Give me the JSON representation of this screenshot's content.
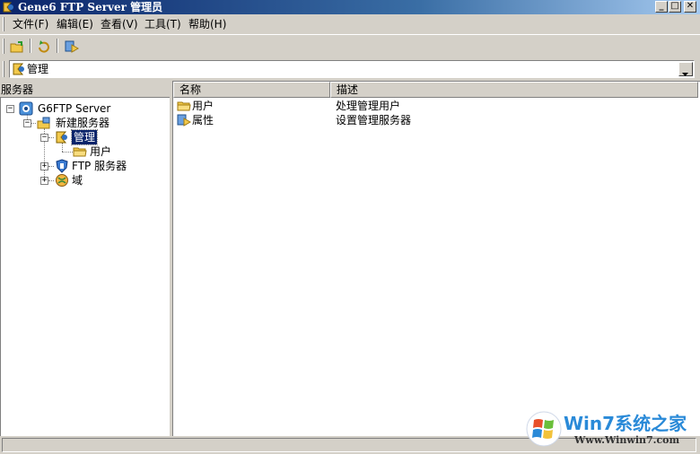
{
  "window": {
    "title": "Gene6 FTP Server 管理员"
  },
  "caption_buttons": {
    "minimize": "_",
    "maximize": "□",
    "close": "✕"
  },
  "menu": [
    {
      "label": "文件(F)"
    },
    {
      "label": "编辑(E)"
    },
    {
      "label": "查看(V)"
    },
    {
      "label": "工具(T)"
    },
    {
      "label": "帮助(H)"
    }
  ],
  "toolbar": {
    "buttons": [
      {
        "icon": "connect-folder-icon"
      },
      {
        "icon": "refresh-icon"
      },
      {
        "icon": "properties-icon"
      }
    ]
  },
  "address": {
    "value": "管理",
    "icon": "admin-icon"
  },
  "tree": {
    "header": "服务器",
    "root": {
      "label": "G6FTP Server",
      "icon": "g6-server-icon",
      "expander": "−"
    },
    "server": {
      "label": "新建服务器",
      "icon": "server-icon",
      "expander": "−"
    },
    "admin": {
      "label": "管理",
      "icon": "admin-icon",
      "expander": "−",
      "selected": true
    },
    "users": {
      "label": "用户",
      "icon": "folder-icon"
    },
    "ftp": {
      "label": "FTP 服务器",
      "icon": "ftp-shield-icon",
      "expander": "+"
    },
    "domain": {
      "label": "域",
      "icon": "globe-icon",
      "expander": "+"
    }
  },
  "list": {
    "columns": [
      "名称",
      "描述"
    ],
    "rows": [
      {
        "name": "用户",
        "desc": "处理管理用户",
        "icon": "folder-icon"
      },
      {
        "name": "属性",
        "desc": "设置管理服务器",
        "icon": "properties-icon"
      }
    ]
  },
  "watermark": {
    "text": "Win7系统之家",
    "site": "Www.Winwin7.com"
  },
  "colors": {
    "titlebar_start": "#0a246a",
    "titlebar_end": "#a6caf0",
    "selection": "#0a246a",
    "chrome": "#d4d0c8"
  }
}
